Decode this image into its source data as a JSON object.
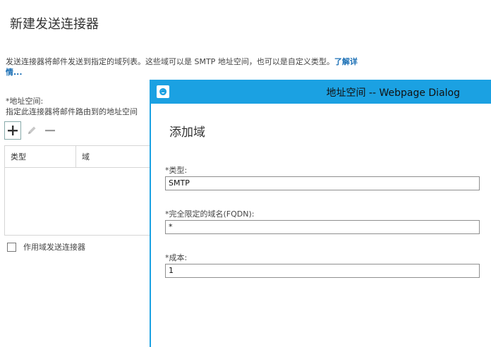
{
  "page": {
    "title": "新建发送连接器",
    "description": "发送连接器将邮件发送到指定的域列表。这些域可以是 SMTP 地址空间，也可以是自定义类型。",
    "learn_more": "了解详情...",
    "address_space_label": "*地址空间:",
    "address_space_help": "指定此连接器将邮件路由到的地址空间",
    "table": {
      "columns": [
        "类型",
        "域"
      ]
    },
    "scoped_connector_label": "作用域发送连接器",
    "scoped_connector_checked": false
  },
  "toolbar": {
    "add_icon": "plus-icon",
    "edit_icon": "pencil-icon",
    "remove_icon": "minus-icon"
  },
  "dialog": {
    "title": "地址空间 -- Webpage Dialog",
    "icon": "ie-icon",
    "heading": "添加域",
    "fields": {
      "type": {
        "label": "*类型:",
        "value": "SMTP"
      },
      "fqdn": {
        "label": "*完全限定的域名(FQDN):",
        "value": "*"
      },
      "cost": {
        "label": "*成本:",
        "value": "1"
      }
    }
  },
  "colors": {
    "accent": "#1ba1e2",
    "link": "#1a6fb5"
  }
}
